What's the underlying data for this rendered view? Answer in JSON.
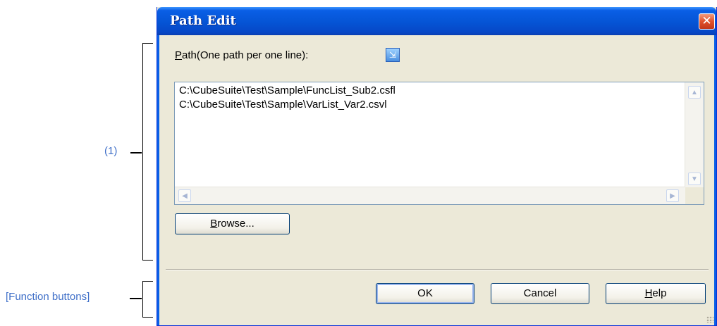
{
  "callouts": {
    "item1": "(1)",
    "function_buttons": "[Function buttons]"
  },
  "dialog": {
    "title": "Path Edit",
    "close_symbol": "✕",
    "path_label_hotkey": "P",
    "path_label_rest": "ath(One path per one line):",
    "paths": [
      "C:\\CubeSuite\\Test\\Sample\\FuncList_Sub2.csfl",
      "C:\\CubeSuite\\Test\\Sample\\VarList_Var2.csvl"
    ],
    "browse": {
      "hotkey": "B",
      "rest": "rowse..."
    },
    "ok_label": "OK",
    "cancel_label": "Cancel",
    "help": {
      "hotkey": "H",
      "rest": "elp"
    }
  },
  "icons": {
    "path_label_icon": "folder-browse-icon",
    "scroll_up": "▲",
    "scroll_down": "▼",
    "scroll_left": "◀",
    "scroll_right": "▶"
  },
  "colors": {
    "callout": "#3f6fc8",
    "titlebar": "#0554d5",
    "close": "#e0512c",
    "dialog_bg": "#ece9d8"
  }
}
